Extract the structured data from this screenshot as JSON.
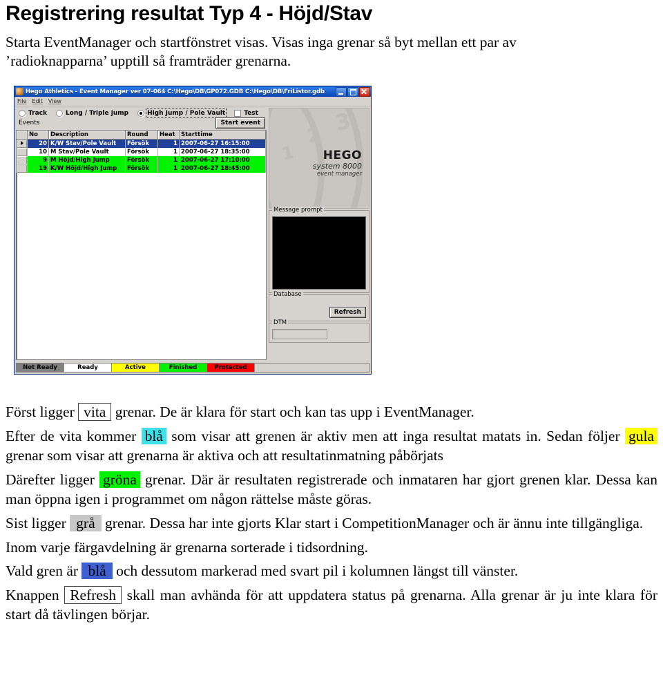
{
  "document": {
    "title": "Registrering resultat Typ 4 - Höjd/Stav",
    "intro_line1": "Starta EventManager och startfönstret visas. Visas inga grenar så byt mellan ett par av",
    "intro_line2": "’radioknapparna’ upptill så framträder grenarna."
  },
  "screenshot": {
    "window": {
      "title": "Hego Athletics - Event Manager ver 07-064  C:\\Hego\\DB\\GP072.GDB C:\\Hego\\DB\\FriListor.gdb",
      "app_icon": "hego-app-icon",
      "controls": {
        "minimize": "minimize-icon",
        "maximize": "maximize-icon",
        "close": "close-icon"
      }
    },
    "menu": [
      "File",
      "Edit",
      "View"
    ],
    "mode_options": [
      {
        "label": "Track",
        "selected": false
      },
      {
        "label": "Long / Triple jump",
        "selected": false
      },
      {
        "label": "High Jump / Pole Vault",
        "selected": true
      }
    ],
    "test_checkbox": {
      "label": "Test",
      "checked": false
    },
    "events_label": "Events",
    "start_event_button": "Start event",
    "grid": {
      "columns": [
        "No",
        "Description",
        "Round",
        "Heat",
        "Starttime"
      ],
      "rows": [
        {
          "marker": "selected",
          "state": "selected",
          "no": "20",
          "description": "K/W Stav/Pole Vault",
          "round": "Försök",
          "heat": "1",
          "starttime": "2007-06-27 16:15:00"
        },
        {
          "marker": "",
          "state": "white",
          "no": "10",
          "description": "M Stav/Pole Vault",
          "round": "Försök",
          "heat": "1",
          "starttime": "2007-06-27 18:35:00"
        },
        {
          "marker": "",
          "state": "green",
          "no": "9",
          "description": "M Höjd/High Jump",
          "round": "Försök",
          "heat": "1",
          "starttime": "2007-06-27 17:10:00"
        },
        {
          "marker": "",
          "state": "green",
          "no": "19",
          "description": "K/W Höjd/High Jump",
          "round": "Försök",
          "heat": "1",
          "starttime": "2007-06-27 18:45:00"
        }
      ]
    },
    "logo": {
      "brand": "HEGO",
      "system": "system 8000",
      "subtitle": "event manager",
      "lane_numbers": [
        "1",
        "2",
        "3"
      ]
    },
    "panels": {
      "message_prompt_title": "Message prompt",
      "database_title": "Database",
      "refresh_button": "Refresh",
      "dtm_title": "DTM",
      "dtm_value": ""
    },
    "legend": [
      {
        "label": "Not Ready",
        "color": "#808080"
      },
      {
        "label": "Ready",
        "color": "#ffffff"
      },
      {
        "label": "Active",
        "color": "#ffff00"
      },
      {
        "label": "Finished",
        "color": "#00f200"
      },
      {
        "label": "Protected",
        "color": "#fe0000"
      }
    ]
  },
  "explanation": {
    "p1_a": "Först ligger ",
    "p1_kw": "vita",
    "p1_b": " grenar. De är klara för start och kan tas upp i EventManager.",
    "p2_a": "Efter de vita kommer ",
    "p2_kw1": "blå",
    "p2_b": " som visar att grenen är aktiv men att inga resultat matats in. Sedan följer ",
    "p2_kw2": "gula",
    "p2_c": " grenar som visar att grenarna är aktiva och att resultatinmatning påbörjats",
    "p3_a": "Därefter ligger ",
    "p3_kw": "gröna",
    "p3_b": " grenar. Där är resultaten registrerade och inmataren har gjort grenen klar. Dessa kan man öppna igen i programmet om någon rättelse måste göras.",
    "p4_a": "Sist ligger ",
    "p4_kw": "grå",
    "p4_b": " grenar. Dessa har inte gjorts Klar start i CompetitionManager och är ännu inte tillgängliga.",
    "p5": "Inom varje färgavdelning är grenarna sorterade i tidsordning.",
    "p6_a": "Vald gren är ",
    "p6_kw": "blå",
    "p6_b": " och dessutom markerad med svart pil i kolumnen längst till vänster.",
    "p7_a": "Knappen ",
    "p7_kw": "Refresh",
    "p7_b": " skall man avhända för att uppdatera status på grenarna. Alla grenar är ju inte klara för start då tävlingen börjar."
  }
}
